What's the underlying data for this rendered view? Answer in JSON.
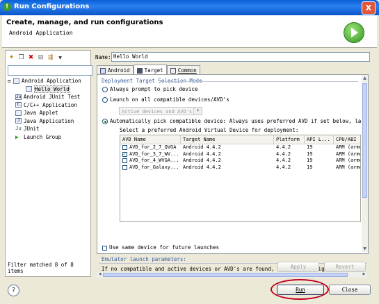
{
  "window": {
    "title": "Run Configurations",
    "close_glyph": "X"
  },
  "header": {
    "title": "Create, manage, and run configurations",
    "subtitle": "Android Application",
    "icon": "run-icon"
  },
  "left": {
    "filter_value": "",
    "tree": [
      {
        "label": "Android Application",
        "expanded": true
      },
      {
        "label": "Hello World",
        "child": true,
        "selected": true
      },
      {
        "label": "Android JUnit Test"
      },
      {
        "label": "C/C++ Application"
      },
      {
        "label": "Java Applet"
      },
      {
        "label": "Java Application"
      },
      {
        "label": "JUnit"
      },
      {
        "label": "Launch Group"
      }
    ],
    "status": "Filter matched 8 of 8 items"
  },
  "right": {
    "name_label": "Name:",
    "name_value": "Hello World",
    "tabs": [
      {
        "label": "Android"
      },
      {
        "label": "Target",
        "active": true
      },
      {
        "label": "Common"
      }
    ],
    "group_title": "Deployment Target Selection Mode",
    "radio_always": "Always prompt to pick device",
    "radio_launch_all": "Launch on all compatible devices/AVD's",
    "combo_value": "Active devices and AVD's",
    "radio_auto": "Automatically pick compatible device: Always uses preferred AVD if set below, launches on",
    "select_label": "Select a preferred Android Virtual Device for deployment:",
    "columns": [
      "AVD Name",
      "Target Name",
      "Platform",
      "API L...",
      "CPU/ABI"
    ],
    "rows": [
      {
        "checked": false,
        "cells": [
          "AVD_for_2_7_QVGA",
          "Android 4.4.2",
          "4.4.2",
          "19",
          "ARM (armea"
        ]
      },
      {
        "checked": true,
        "cells": [
          "AVD_for_3_7_WV...",
          "Android 4.4.2",
          "4.4.2",
          "19",
          "ARM (armea"
        ]
      },
      {
        "checked": false,
        "cells": [
          "AVD_for_4_WVGA...",
          "Android 4.4.2",
          "4.4.2",
          "19",
          "ARM (armea"
        ]
      },
      {
        "checked": false,
        "cells": [
          "AVD_for_Galaxy...",
          "Android 4.4.2",
          "4.4.2",
          "19",
          "ARM (armea"
        ]
      }
    ],
    "same_device": "Use same device for future launches",
    "emulator_title": "Emulator launch parameters:",
    "note": "If no compatible and active devices or AVD's are found, then an AVD might be launched. Prov",
    "apply": "Apply",
    "revert": "Revert"
  },
  "footer": {
    "run": "Run",
    "close": "Close",
    "help": "?"
  }
}
